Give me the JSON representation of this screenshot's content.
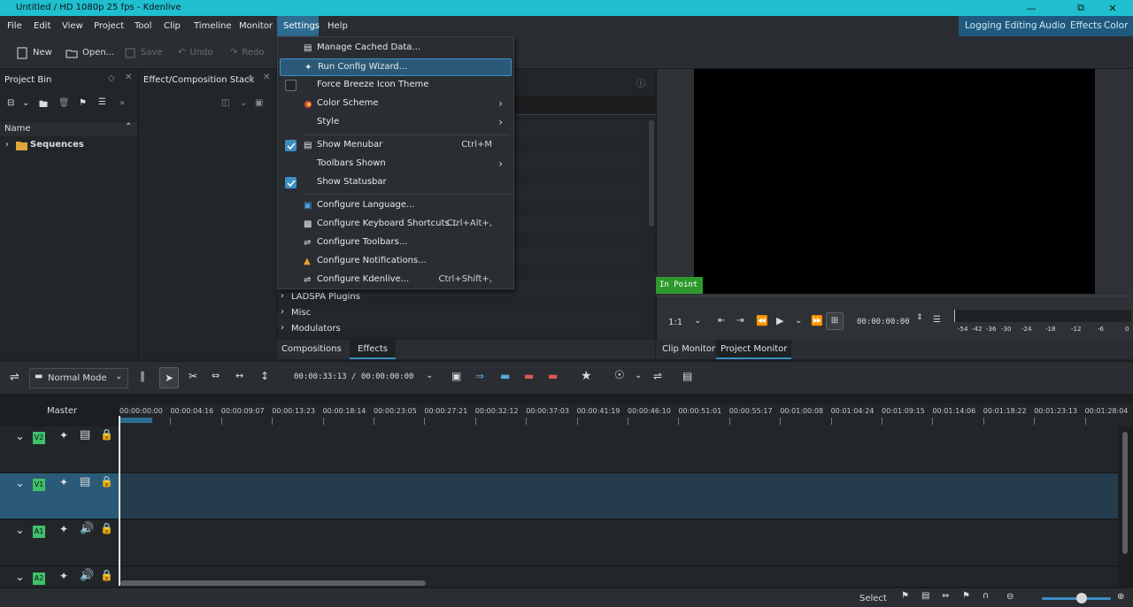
{
  "window": {
    "title": "Untitled / HD 1080p 25 fps - Kdenlive"
  },
  "menubar": {
    "items": [
      "File",
      "Edit",
      "View",
      "Project",
      "Tool",
      "Clip",
      "Timeline",
      "Monitor",
      "Settings",
      "Help"
    ],
    "active": "Settings"
  },
  "workspaces": [
    "Logging",
    "Editing",
    "Audio",
    "Effects",
    "Color"
  ],
  "toolbar": {
    "new": "New",
    "open": "Open...",
    "save": "Save",
    "undo": "Undo",
    "redo": "Redo"
  },
  "project_bin": {
    "title": "Project Bin",
    "column_name": "Name",
    "items": [
      "Sequences"
    ]
  },
  "effect_stack": {
    "title": "Effect/Composition Stack"
  },
  "settings_menu": {
    "items": [
      {
        "label": "Manage Cached Data...",
        "shortcut": ""
      },
      {
        "label": "Run Config Wizard...",
        "shortcut": ""
      },
      {
        "label": "Force Breeze Icon Theme",
        "shortcut": ""
      },
      {
        "label": "Color Scheme",
        "shortcut": ""
      },
      {
        "label": "Style",
        "shortcut": ""
      },
      {
        "label": "Show Menubar",
        "shortcut": "Ctrl+M"
      },
      {
        "label": "Toolbars Shown",
        "shortcut": ""
      },
      {
        "label": "Show Statusbar",
        "shortcut": ""
      },
      {
        "label": "Configure Language...",
        "shortcut": ""
      },
      {
        "label": "Configure Keyboard Shortcuts...",
        "shortcut": "Ctrl+Alt+,"
      },
      {
        "label": "Configure Toolbars...",
        "shortcut": ""
      },
      {
        "label": "Configure Notifications...",
        "shortcut": ""
      },
      {
        "label": "Configure Kdenlive...",
        "shortcut": "Ctrl+Shift+,"
      }
    ]
  },
  "effects_list": {
    "categories": [
      "LADSPA Plugins",
      "Misc",
      "Modulators"
    ]
  },
  "effects_tabs": [
    "Compositions",
    "Effects"
  ],
  "monitor": {
    "in_point": "In Point",
    "zoom": "1:1",
    "timecode": "00:00:00:00",
    "tabs": [
      "Clip Monitor",
      "Project Monitor"
    ],
    "audio_scale": [
      "-54",
      "-42",
      "-36",
      "-30",
      "-24",
      "-18",
      "-12",
      "-6",
      "0"
    ]
  },
  "timeline": {
    "mode": "Normal Mode",
    "timecode": "00:00:33:13 / 00:00:00:00",
    "master": "Master",
    "ruler": [
      "00:00:00:00",
      "00:00:04:16",
      "00:00:09:07",
      "00:00:13:23",
      "00:00:18:14",
      "00:00:23:05",
      "00:00:27:21",
      "00:00:32:12",
      "00:00:37:03",
      "00:00:41:19",
      "00:00:46:10",
      "00:00:51:01",
      "00:00:55:17",
      "00:01:00:08",
      "00:01:04:24",
      "00:01:09:15",
      "00:01:14:06",
      "00:01:18:22",
      "00:01:23:13",
      "00:01:28:04"
    ],
    "tracks": [
      "V2",
      "V1",
      "A1",
      "A2"
    ]
  },
  "statusbar": {
    "mode": "Select"
  },
  "colors": {
    "accent": "#3d8ec3",
    "titlebar": "#1fbfcf",
    "track_label": "#3fbf6a",
    "in_point": "#2e9a2e"
  }
}
